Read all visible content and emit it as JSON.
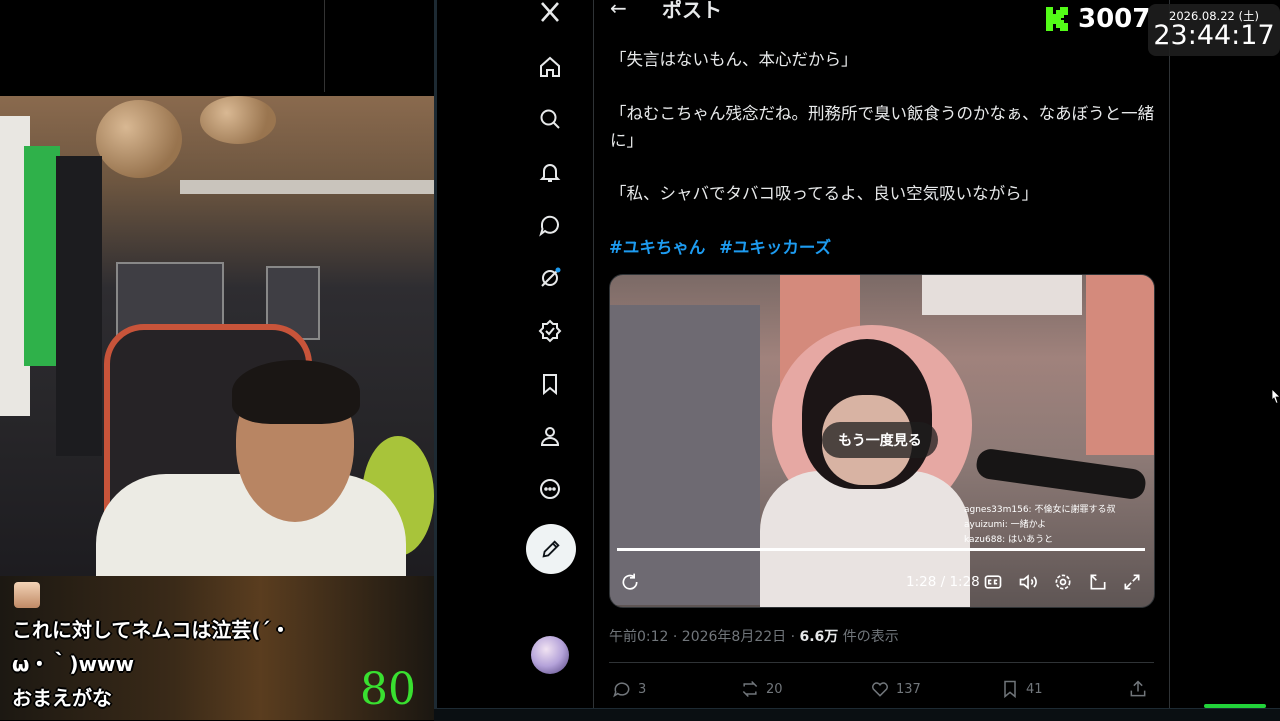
{
  "stream": {
    "chat_lines": [
      "これに対してネムコは泣芸(´・",
      "ω・｀)www",
      "おまえがな"
    ],
    "score": "80"
  },
  "x": {
    "post_header": "ポスト",
    "tweet_lines": [
      "「失言はないもん、本心だから」",
      "「ねむこちゃん残念だね。刑務所で臭い飯食うのかなぁ、なあぼうと一緒",
      "に」",
      "「私、シャバでタバコ吸ってるよ、良い空気吸いながら」"
    ],
    "hashtags": [
      "#ユキちゃん",
      "#ユキッカーズ"
    ],
    "video": {
      "replay_label": "もう一度見る",
      "time": "1:28 / 1:28",
      "progress": 1.0,
      "chat_overlay": [
        "agnes33m156: 不倫女に謝罪する叔",
        "ayuizumi: 一緒かよ",
        "kazu688: はいあうと"
      ]
    },
    "meta": {
      "time": "午前0:12 · 2026年8月22日 · ",
      "views": "6.6万",
      "views_suffix": " 件の表示"
    },
    "actions": {
      "replies": "3",
      "reposts": "20",
      "likes": "137",
      "bookmarks": "41"
    },
    "nav_icons": [
      "x-logo-icon",
      "home-icon",
      "search-icon",
      "notifications-icon",
      "messages-icon",
      "grok-icon",
      "verified-icon",
      "bookmarks-icon",
      "profile-icon",
      "more-icon"
    ]
  },
  "overlay": {
    "viewer_count": "3007",
    "date": "2026.08.22 (土)",
    "time": "23:44:17"
  },
  "colors": {
    "accent_blue": "#1d9bf0",
    "kick_green": "#53fc18",
    "score_green": "#39e030"
  }
}
